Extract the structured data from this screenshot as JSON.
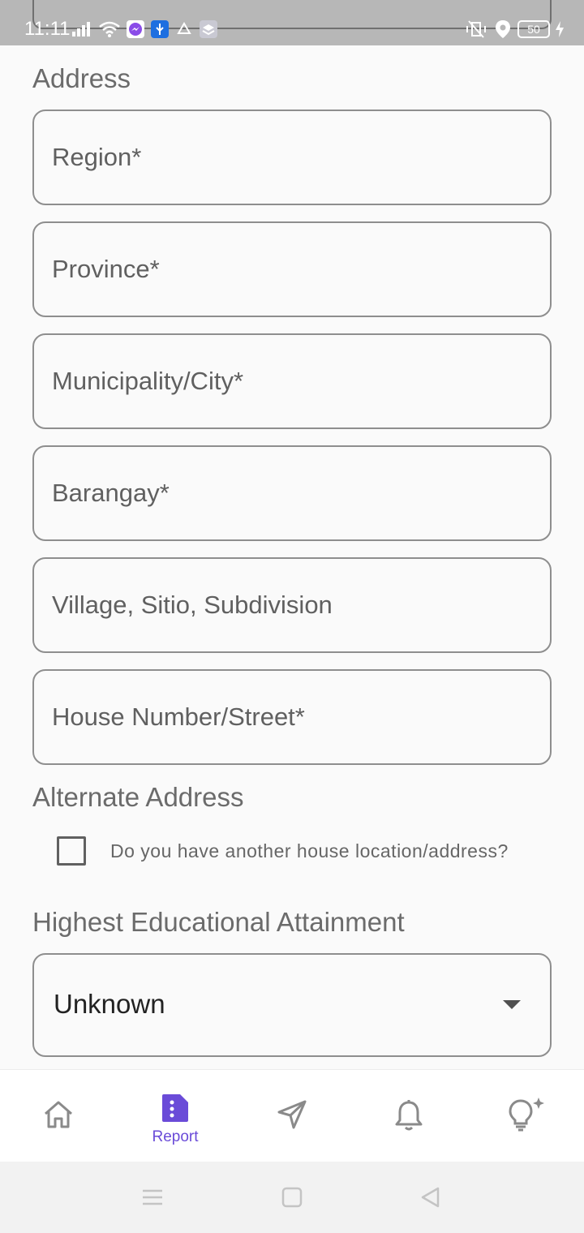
{
  "status_bar": {
    "time": "11:11",
    "battery": "50",
    "left_icons": [
      "signal-icon",
      "wifi-icon",
      "messenger-icon",
      "usb-icon",
      "drive-icon",
      "layers-icon"
    ],
    "right_icons": [
      "mute-vibrate-icon",
      "location-icon",
      "battery-icon",
      "charging-icon"
    ]
  },
  "address": {
    "title": "Address",
    "fields": [
      {
        "placeholder": "Region*",
        "value": ""
      },
      {
        "placeholder": "Province*",
        "value": ""
      },
      {
        "placeholder": "Municipality/City*",
        "value": ""
      },
      {
        "placeholder": "Barangay*",
        "value": ""
      },
      {
        "placeholder": "Village, Sitio, Subdivision",
        "value": ""
      },
      {
        "placeholder": "House Number/Street*",
        "value": ""
      }
    ]
  },
  "alternate_address": {
    "title": "Alternate Address",
    "checkbox_label": "Do you have another house location/address?",
    "checked": false
  },
  "education": {
    "title": "Highest Educational Attainment",
    "selected": "Unknown"
  },
  "bottom_nav": {
    "items": [
      {
        "name": "home",
        "icon": "home-icon",
        "label": ""
      },
      {
        "name": "report",
        "icon": "report-icon",
        "label": "Report",
        "active": true
      },
      {
        "name": "send",
        "icon": "send-icon",
        "label": ""
      },
      {
        "name": "notifications",
        "icon": "bell-icon",
        "label": ""
      },
      {
        "name": "tips",
        "icon": "lightbulb-icon",
        "label": ""
      }
    ]
  },
  "colors": {
    "accent": "#6a4bd8",
    "status_bar": "#b7b7b7",
    "field_border": "#8e8e8e",
    "background": "#fafafa"
  }
}
